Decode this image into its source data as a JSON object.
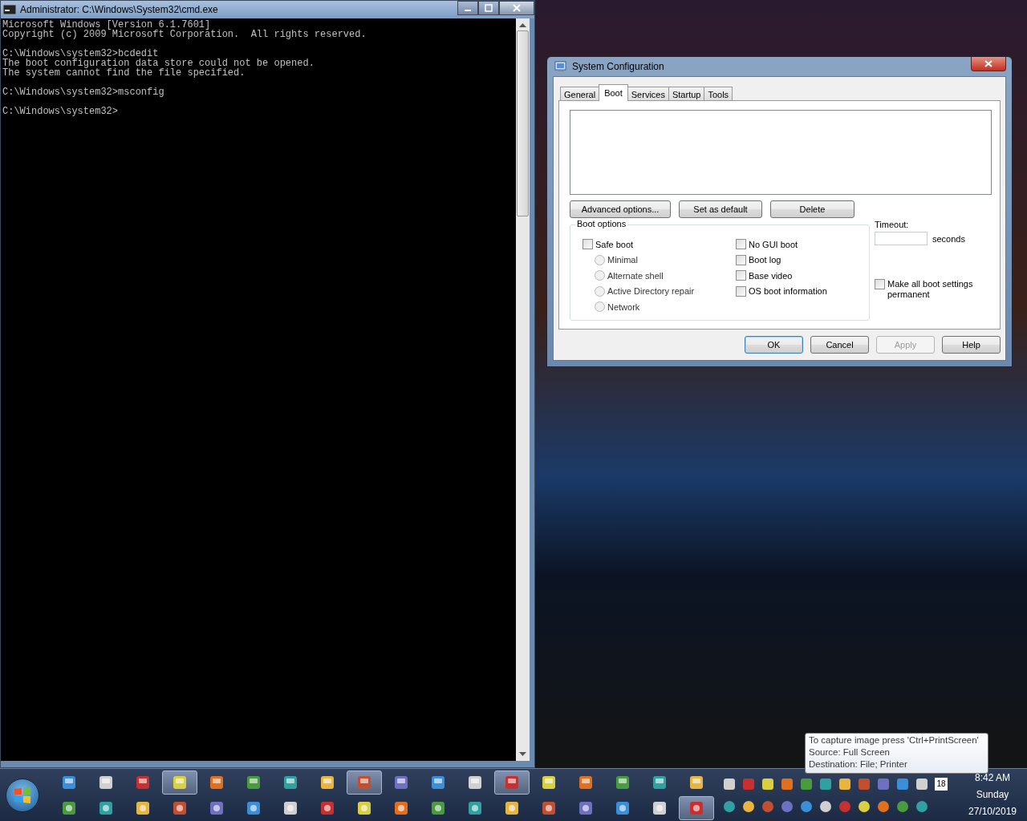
{
  "console": {
    "title": "Administrator: C:\\Windows\\System32\\cmd.exe",
    "blocks": [
      [
        "Microsoft Windows [Version 6.1.7601]",
        "Copyright (c) 2009 Microsoft Corporation.  All rights reserved."
      ],
      [
        "C:\\Windows\\system32>bcdedit",
        "The boot configuration data store could not be opened.",
        "The system cannot find the file specified."
      ],
      [
        "C:\\Windows\\system32>msconfig"
      ],
      [
        "C:\\Windows\\system32>"
      ]
    ]
  },
  "dialog": {
    "title": "System Configuration",
    "tabs": [
      {
        "label": "General",
        "selected": false
      },
      {
        "label": "Boot",
        "selected": true
      },
      {
        "label": "Services",
        "selected": false
      },
      {
        "label": "Startup",
        "selected": false
      },
      {
        "label": "Tools",
        "selected": false
      }
    ],
    "entry_buttons": [
      {
        "label": "Advanced options...",
        "disabled": false
      },
      {
        "label": "Set as default",
        "disabled": false
      },
      {
        "label": "Delete",
        "disabled": false
      }
    ],
    "boot_options": {
      "label": "Boot options",
      "left": [
        {
          "kind": "checkbox",
          "label": "Safe boot",
          "checked": false,
          "disabled": false
        },
        {
          "kind": "radio",
          "label": "Minimal",
          "selected": false,
          "disabled": true
        },
        {
          "kind": "radio",
          "label": "Alternate shell",
          "selected": false,
          "disabled": true
        },
        {
          "kind": "radio",
          "label": "Active Directory repair",
          "selected": false,
          "disabled": true
        },
        {
          "kind": "radio",
          "label": "Network",
          "selected": false,
          "disabled": true
        }
      ],
      "right": [
        {
          "kind": "checkbox",
          "label": "No GUI boot",
          "checked": false,
          "disabled": false
        },
        {
          "kind": "checkbox",
          "label": "Boot log",
          "checked": false,
          "disabled": false
        },
        {
          "kind": "checkbox",
          "label": "Base video",
          "checked": false,
          "disabled": false
        },
        {
          "kind": "checkbox",
          "label": "OS boot information",
          "checked": false,
          "disabled": false
        }
      ]
    },
    "timeout": {
      "label": "Timeout:",
      "unit": "seconds"
    },
    "permanent": {
      "label": "Make all boot settings permanent",
      "checked": false
    },
    "footer_buttons": [
      {
        "label": "OK",
        "default": true,
        "disabled": false
      },
      {
        "label": "Cancel",
        "default": false,
        "disabled": false
      },
      {
        "label": "Apply",
        "default": false,
        "disabled": true
      },
      {
        "label": "Help",
        "default": false,
        "disabled": false
      }
    ]
  },
  "tooltip": {
    "lines": [
      "To capture image press 'Ctrl+PrintScreen'",
      "Source:  Full Screen",
      "Destination:  File; Printer"
    ]
  },
  "taskbar": {
    "top_row": [
      {
        "selected": false
      },
      {
        "selected": false
      },
      {
        "selected": false
      },
      {
        "selected": true
      },
      {
        "selected": false
      },
      {
        "selected": false
      },
      {
        "selected": false
      },
      {
        "selected": false
      },
      {
        "selected": true
      },
      {
        "selected": false
      },
      {
        "selected": false
      },
      {
        "selected": false
      },
      {
        "selected": true
      },
      {
        "selected": false
      },
      {
        "selected": false
      },
      {
        "selected": false
      },
      {
        "selected": false
      },
      {
        "selected": false
      }
    ],
    "bottom_row": [
      {
        "selected": false
      },
      {
        "selected": false
      },
      {
        "selected": false
      },
      {
        "selected": false
      },
      {
        "selected": false
      },
      {
        "selected": false
      },
      {
        "selected": false
      },
      {
        "selected": false
      },
      {
        "selected": false
      },
      {
        "selected": false
      },
      {
        "selected": false
      },
      {
        "selected": false
      },
      {
        "selected": false
      },
      {
        "selected": false
      },
      {
        "selected": false
      },
      {
        "selected": false
      },
      {
        "selected": false
      },
      {
        "selected": true
      }
    ],
    "tray_badge": "18",
    "clock": {
      "time": "8:42 AM",
      "day": "Sunday",
      "date": "27/10/2019"
    }
  }
}
